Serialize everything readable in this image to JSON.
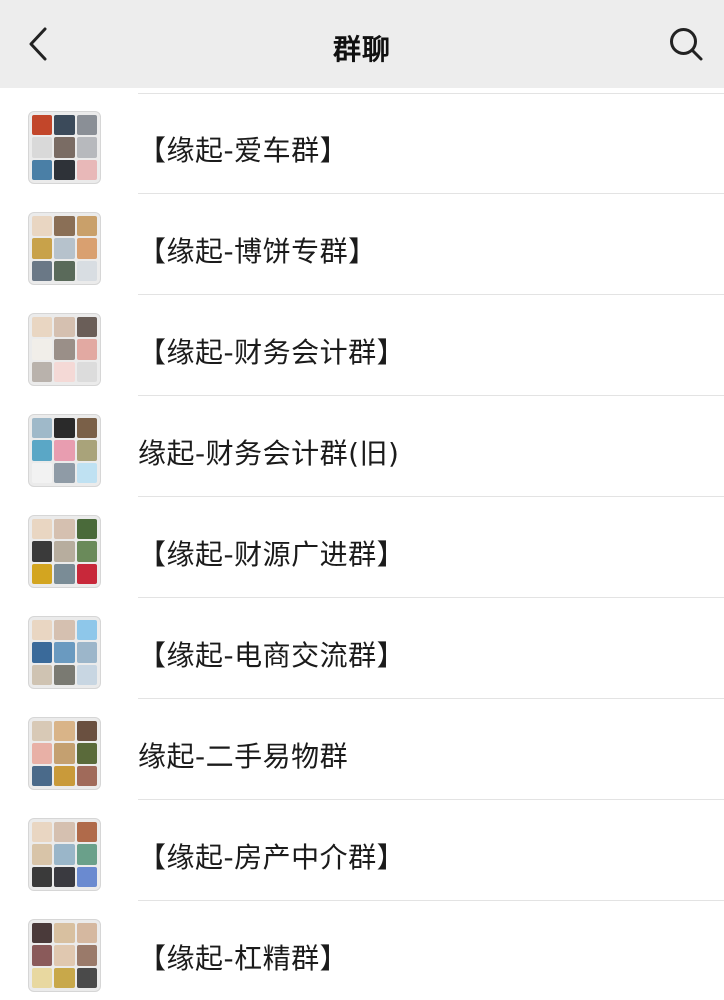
{
  "header": {
    "title": "群聊"
  },
  "groups": [
    {
      "name": "【缘起-爱车群】",
      "avatar_colors": [
        "#c2462a",
        "#3b4a5a",
        "#8a8f96",
        "#d9d9d9",
        "#7a6c64",
        "#b7b9bd",
        "#4a7fa6",
        "#2e3238",
        "#e8b8b8"
      ]
    },
    {
      "name": "【缘起-博饼专群】",
      "avatar_colors": [
        "#e9d6c2",
        "#8a6f56",
        "#c9a06a",
        "#c8a24a",
        "#b6c2cc",
        "#d9a070",
        "#6a7886",
        "#5a6a5a",
        "#d8dde2"
      ]
    },
    {
      "name": "【缘起-财务会计群】",
      "avatar_colors": [
        "#e9d6c2",
        "#d5c0b0",
        "#6a5e58",
        "#f1eee9",
        "#9a8f88",
        "#e2a9a2",
        "#b9b2ac",
        "#f4d9d6",
        "#dcdcdc"
      ]
    },
    {
      "name": "缘起-财务会计群(旧)",
      "avatar_colors": [
        "#9fb9c9",
        "#2a2a2a",
        "#7a6048",
        "#5aa7c6",
        "#e89db0",
        "#a9a37a",
        "#f2f2f2",
        "#8f9ba6",
        "#bfe1f2"
      ]
    },
    {
      "name": "【缘起-财源广进群】",
      "avatar_colors": [
        "#e9d6c2",
        "#d5c0b0",
        "#4a6a3a",
        "#3a3a3a",
        "#b7ad9e",
        "#6a8a5a",
        "#d3a520",
        "#7a8c96",
        "#c8283a"
      ]
    },
    {
      "name": "【缘起-电商交流群】",
      "avatar_colors": [
        "#e9d6c2",
        "#d5c0b0",
        "#8ec7ea",
        "#3a6a9a",
        "#6a9ac0",
        "#9cb6ca",
        "#cfc3b2",
        "#7a7a72",
        "#c8d6e2"
      ]
    },
    {
      "name": "缘起-二手易物群",
      "avatar_colors": [
        "#d8c9b6",
        "#d9b488",
        "#6a5040",
        "#e8b0a6",
        "#c4a070",
        "#5a6a3a",
        "#4a6a8a",
        "#c99a3a",
        "#a06a5a"
      ]
    },
    {
      "name": "【缘起-房产中介群】",
      "avatar_colors": [
        "#e9d6c2",
        "#d5c0b0",
        "#b06a4a",
        "#d8c4a8",
        "#9ab6c9",
        "#6aa08a",
        "#3a3a3a",
        "#3a3a40",
        "#6a8ad0"
      ]
    },
    {
      "name": "【缘起-杠精群】",
      "avatar_colors": [
        "#4a3a3a",
        "#d8c0a0",
        "#d5b8a0",
        "#8a5a5a",
        "#e0c8b0",
        "#9a7a6a",
        "#e8d8a0",
        "#c8a84a",
        "#4a4a4a"
      ]
    }
  ]
}
